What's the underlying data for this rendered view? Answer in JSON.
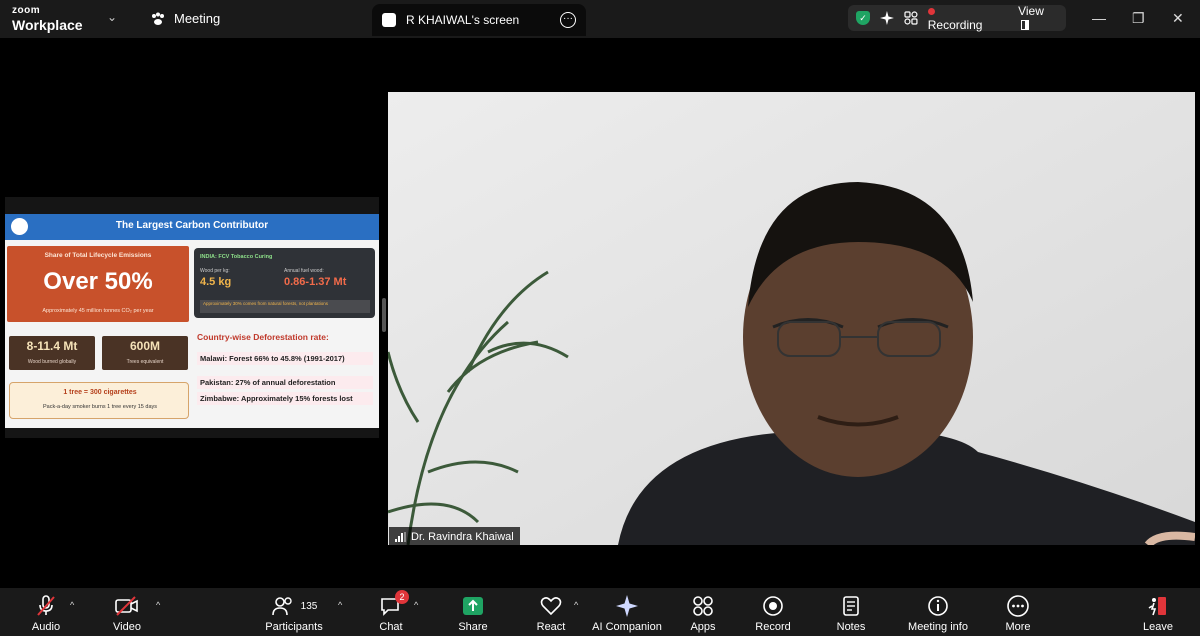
{
  "titlebar": {
    "brand_top": "zoom",
    "brand_bottom": "Workplace",
    "meeting_label": "Meeting",
    "screen_tab": "R KHAIWAL's screen",
    "recording_label": "Recording",
    "view_label": "View"
  },
  "slide": {
    "title": "The Largest Carbon Contributor",
    "orange_caption": "Share of Total Lifecycle Emissions",
    "orange_value": "Over 50%",
    "orange_sub": "Approximately 45 million tonnes CO₂ per year",
    "stat1_value": "8-11.4 Mt",
    "stat1_label": "Wood burned globally",
    "stat2_value": "600M",
    "stat2_label": "Trees equivalent",
    "tree_line": "1 tree = 300 cigarettes",
    "tree_sub": "Pack-a-day smoker burns 1 tree every 15 days",
    "india_header": "INDIA: FCV Tobacco Curing",
    "india_l1": "Wood per kg:",
    "india_v1": "4.5 kg",
    "india_l2": "Annual fuel wood:",
    "india_v2": "0.86-1.37 Mt",
    "india_note": "Approximately 30% comes from natural forests, not plantations",
    "defo_title": "Country-wise Deforestation rate:",
    "defo_malawi": "Malawi: Forest 66% to 45.8% (1991-2017)",
    "defo_pakistan": "Pakistan: 27% of annual deforestation",
    "defo_zimbabwe": "Zimbabwe: Approximately 15% forests lost"
  },
  "video": {
    "participant_name": "Dr. Ravindra Khaiwal"
  },
  "toolbar": {
    "audio": "Audio",
    "video": "Video",
    "participants": "Participants",
    "participants_count": "135",
    "chat": "Chat",
    "chat_badge": "2",
    "share": "Share",
    "react": "React",
    "ai": "AI Companion",
    "apps": "Apps",
    "record": "Record",
    "notes": "Notes",
    "meeting_info": "Meeting info",
    "more": "More",
    "leave": "Leave"
  },
  "colors": {
    "share_green": "#1fa463",
    "leave_red": "#e0353a",
    "slide_blue": "#2a6fc2",
    "slide_orange": "#c8512b"
  }
}
